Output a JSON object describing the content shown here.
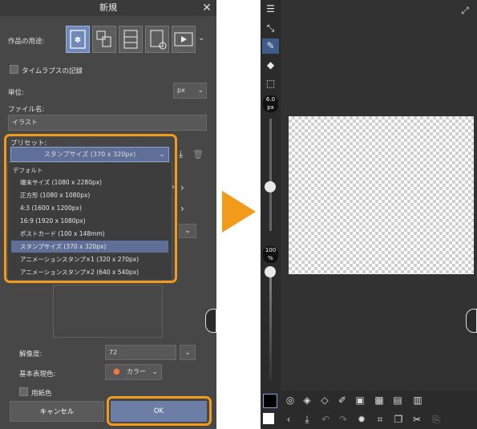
{
  "dialog": {
    "title": "新規",
    "usage_label": "作品の用途:",
    "usage_icons": [
      "illustration-icon",
      "comic-icon",
      "webtoon-icon",
      "print-icon",
      "animation-icon"
    ],
    "timelapse_label": "タイムラプスの記録",
    "unit_label": "単位:",
    "unit_value": "px",
    "filename_label": "ファイル名:",
    "filename_value": "イラスト",
    "preset_label": "プリセット:",
    "preset_value": "スタンプサイズ (370 x 320px)",
    "preset_options_header": "デフォルト",
    "preset_options": [
      "端末サイズ (1080 x 2280px)",
      "正方形 (1080 x 1080px)",
      "4:3 (1600 x 1200px)",
      "16:9 (1920 x 1080px)",
      "ポストカード (100 x 148mm)",
      "スタンプサイズ (370 x 320px)",
      "アニメーションスタンプ×1 (320 x 270px)",
      "アニメーションスタンプ×2 (640 x 540px)"
    ],
    "resolution_label": "解像度:",
    "resolution_value": "72",
    "color_label": "基本表現色:",
    "color_value": "カラー",
    "paper_label": "用紙色",
    "cancel_label": "キャンセル",
    "ok_label": "OK"
  },
  "canvas_window": {
    "brush_size": "6.0",
    "brush_size_unit": "px",
    "opacity": "100",
    "opacity_unit": "%"
  },
  "colors": {
    "highlight": "#f29a1a",
    "accent": "#5f6f98",
    "ok_button": "#6c7ea6"
  }
}
